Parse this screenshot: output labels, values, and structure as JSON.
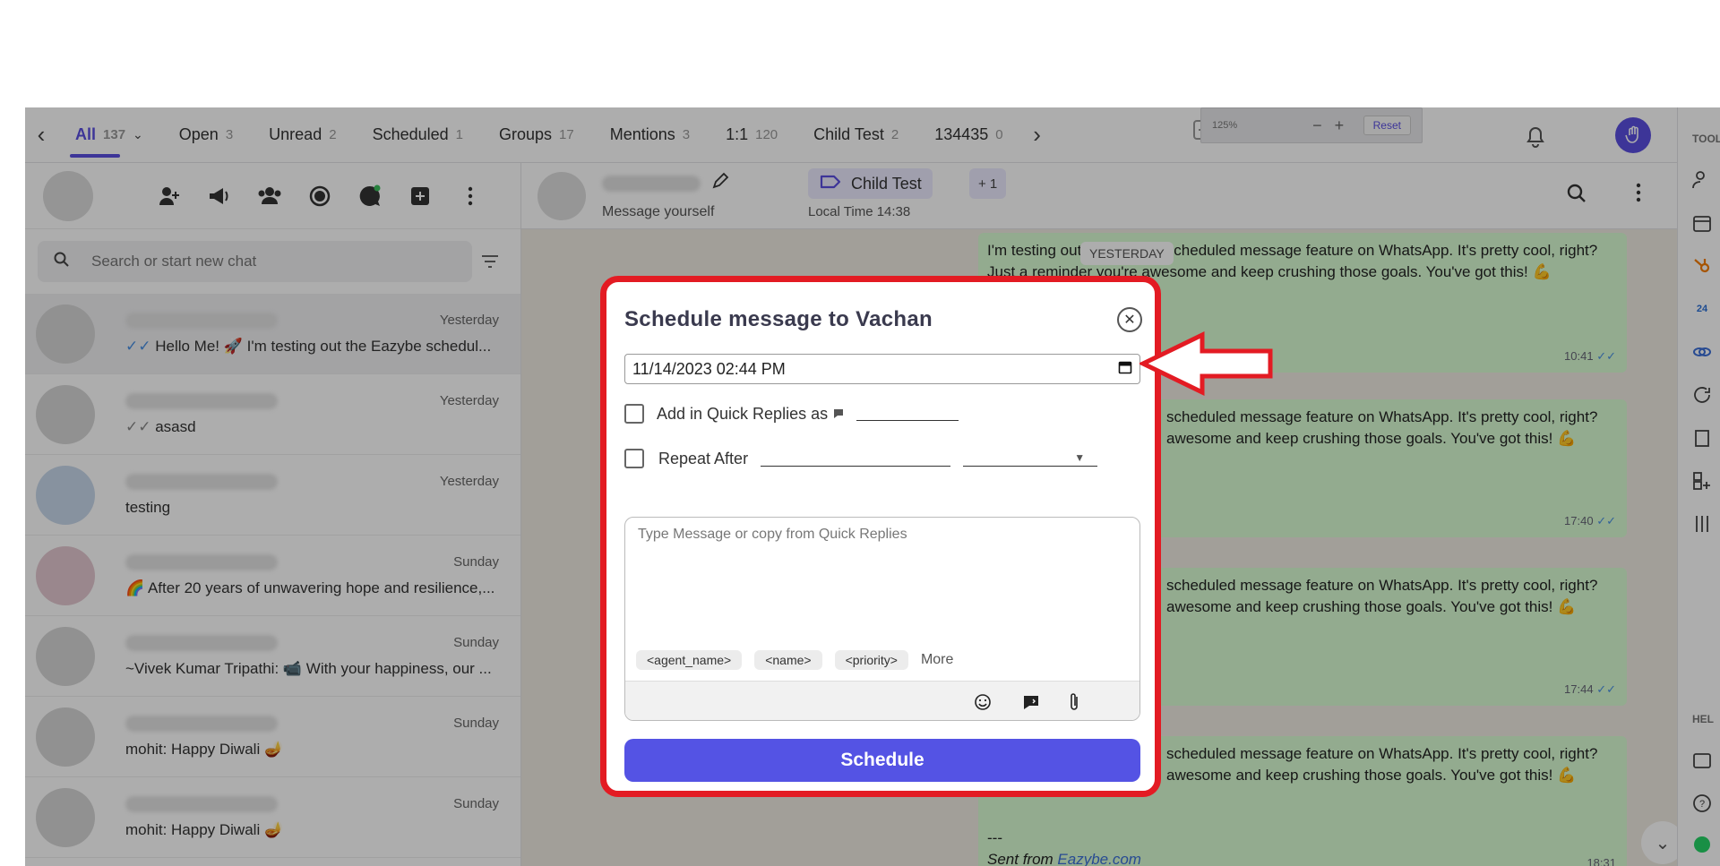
{
  "tabs": {
    "items": [
      {
        "label": "All",
        "count": "137"
      },
      {
        "label": "Open",
        "count": "3"
      },
      {
        "label": "Unread",
        "count": "2"
      },
      {
        "label": "Scheduled",
        "count": "1"
      },
      {
        "label": "Groups",
        "count": "17"
      },
      {
        "label": "Mentions",
        "count": "3"
      },
      {
        "label": "1:1",
        "count": "120"
      },
      {
        "label": "Child Test",
        "count": "2"
      },
      {
        "label": "134435",
        "count": "0"
      }
    ],
    "prev_icon": "chevron-left-icon",
    "next_icon": "chevron-right-icon"
  },
  "zoom": {
    "level": "125%",
    "reset_label": "Reset"
  },
  "search": {
    "placeholder": "Search or start new chat"
  },
  "chats": [
    {
      "time": "Yesterday",
      "preview": "Hello Me! 🚀  I'm testing out the Eazybe schedul...",
      "ticks": true
    },
    {
      "time": "Yesterday",
      "preview": "asasd",
      "ticks": true
    },
    {
      "time": "Yesterday",
      "preview": "testing",
      "ticks": false
    },
    {
      "time": "Sunday",
      "preview": "🌈 After 20 years of unwavering hope and resilience,...",
      "ticks": false
    },
    {
      "time": "Sunday",
      "preview": "~Vivek Kumar Tripathi: 📹 With your happiness, our ...",
      "ticks": false
    },
    {
      "time": "Sunday",
      "preview": "mohit: Happy Diwali 🪔",
      "ticks": false
    },
    {
      "time": "Sunday",
      "preview": "mohit: Happy Diwali 🪔",
      "ticks": false
    }
  ],
  "conversation": {
    "subtitle": "Message yourself",
    "label": "Child Test",
    "label_more": "+ 1",
    "local_time": "Local Time 14:38",
    "date_chip": "YESTERDAY",
    "bubbles": [
      {
        "line1": "I'm testing out the Eazybe scheduled message feature on WhatsApp. It's pretty cool, right?",
        "line2": "Just a reminder you're awesome and keep crushing those goals. You've got this! 💪",
        "time": "10:41"
      },
      {
        "line1": "scheduled message feature on WhatsApp. It's pretty cool, right?",
        "line2": "awesome and keep crushing those goals. You've got this! 💪",
        "time": "17:40"
      },
      {
        "line1": "scheduled message feature on WhatsApp. It's pretty cool, right?",
        "line2": "awesome and keep crushing those goals. You've got this! 💪",
        "time": "17:44"
      },
      {
        "line1": "scheduled message feature on WhatsApp. It's pretty cool, right?",
        "line2": "awesome and keep crushing those goals. You've got this! 💪",
        "time": "18:31"
      }
    ],
    "signature_dashes": "---",
    "sent_from": "Sent from ",
    "sent_link": "Eazybe.com"
  },
  "sidebar_right": {
    "tools_label": "TOOLS",
    "help_label": "HEL"
  },
  "modal": {
    "title": "Schedule message to Vachan",
    "datetime_value": "11/14/2023 02:44 PM",
    "quick_replies_label": "Add in Quick Replies as",
    "repeat_label": "Repeat After",
    "message_placeholder": "Type Message or copy from Quick Replies",
    "variables": [
      "<agent_name>",
      "<name>",
      "<priority>"
    ],
    "more_label": "More",
    "schedule_label": "Schedule"
  },
  "colors": {
    "accent": "#5453e4",
    "highlight_red": "#e31b23",
    "bubble_green": "#d9fdd3"
  }
}
